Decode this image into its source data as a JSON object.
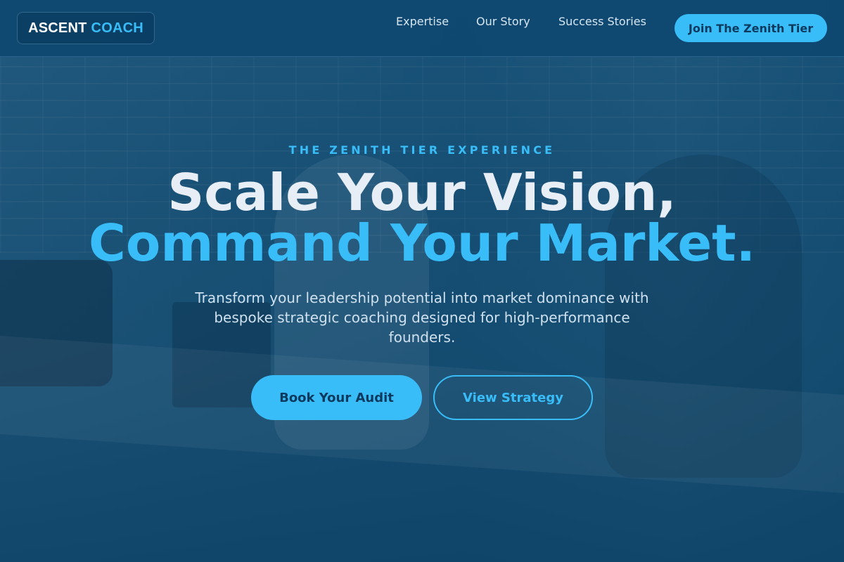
{
  "brand": {
    "part1": "ASCENT",
    "part2": "COACH"
  },
  "nav": {
    "links": [
      "Expertise",
      "Our Story",
      "Success Stories"
    ],
    "cta": "Join The Zenith Tier"
  },
  "hero": {
    "eyebrow": "THE ZENITH TIER EXPERIENCE",
    "headline_line1": "Scale Your Vision,",
    "headline_line2": "Command Your Market.",
    "subtitle": "Transform your leadership potential into market dominance with bespoke strategic coaching designed for high-performance founders.",
    "primary_button": "Book Your Audit",
    "secondary_button": "View Strategy"
  },
  "colors": {
    "accent": "#38bdf8",
    "background": "#0f4a6e",
    "headline": "#e8eef6"
  }
}
